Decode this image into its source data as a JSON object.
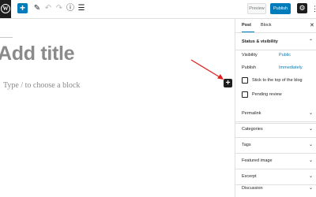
{
  "toolbar": {
    "logo_icon": "wordpress-logo-icon",
    "add_icon": "+",
    "edit_icon": "✎",
    "undo_icon": "↶",
    "redo_icon": "↷",
    "info_icon": "ⓘ",
    "outline_icon": "☰",
    "preview_label": "Preview",
    "publish_label": "Publish",
    "settings_icon": "⚙",
    "more_icon": "⋮"
  },
  "editor": {
    "title_placeholder": "Add title",
    "block_placeholder": "Type / to choose a block",
    "inline_add_icon": "+"
  },
  "sidebar": {
    "tabs": [
      "Post",
      "Block"
    ],
    "close_icon": "✕",
    "status_visibility": {
      "title": "Status & visibility",
      "visibility_label": "Visibility",
      "visibility_value": "Public",
      "publish_label": "Publish",
      "publish_value": "Immediately",
      "sticky_label": "Stick to the top of the blog",
      "pending_label": "Pending review"
    },
    "panels": [
      "Permalink",
      "Categories",
      "Tags",
      "Featured image",
      "Excerpt",
      "Discussion"
    ]
  },
  "colors": {
    "accent": "#007cba",
    "annotation_arrow": "#e02020"
  }
}
